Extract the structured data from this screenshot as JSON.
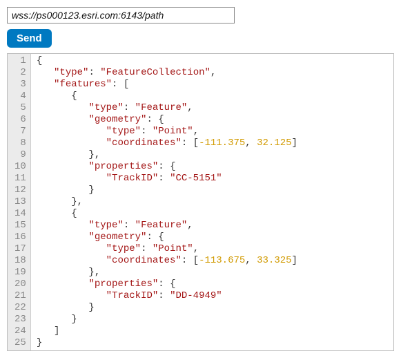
{
  "url_input": {
    "value": "wss://ps000123.esri.com:6143/path"
  },
  "send_button": {
    "label": "Send"
  },
  "code": {
    "line_count": 25,
    "lines": {
      "l1": [
        {
          "t": "{",
          "c": "brace"
        }
      ],
      "l2": [
        {
          "t": "   ",
          "c": "punc"
        },
        {
          "t": "\"type\"",
          "c": "key"
        },
        {
          "t": ": ",
          "c": "punc"
        },
        {
          "t": "\"FeatureCollection\"",
          "c": "str"
        },
        {
          "t": ",",
          "c": "punc"
        }
      ],
      "l3": [
        {
          "t": "   ",
          "c": "punc"
        },
        {
          "t": "\"features\"",
          "c": "key"
        },
        {
          "t": ": [",
          "c": "punc"
        }
      ],
      "l4": [
        {
          "t": "      {",
          "c": "brace"
        }
      ],
      "l5": [
        {
          "t": "         ",
          "c": "punc"
        },
        {
          "t": "\"type\"",
          "c": "key"
        },
        {
          "t": ": ",
          "c": "punc"
        },
        {
          "t": "\"Feature\"",
          "c": "str"
        },
        {
          "t": ",",
          "c": "punc"
        }
      ],
      "l6": [
        {
          "t": "         ",
          "c": "punc"
        },
        {
          "t": "\"geometry\"",
          "c": "key"
        },
        {
          "t": ": {",
          "c": "punc"
        }
      ],
      "l7": [
        {
          "t": "            ",
          "c": "punc"
        },
        {
          "t": "\"type\"",
          "c": "key"
        },
        {
          "t": ": ",
          "c": "punc"
        },
        {
          "t": "\"Point\"",
          "c": "str"
        },
        {
          "t": ",",
          "c": "punc"
        }
      ],
      "l8": [
        {
          "t": "            ",
          "c": "punc"
        },
        {
          "t": "\"coordinates\"",
          "c": "key"
        },
        {
          "t": ": [",
          "c": "punc"
        },
        {
          "t": "-111.375",
          "c": "num"
        },
        {
          "t": ", ",
          "c": "punc"
        },
        {
          "t": "32.125",
          "c": "num"
        },
        {
          "t": "]",
          "c": "punc"
        }
      ],
      "l9": [
        {
          "t": "         },",
          "c": "brace"
        }
      ],
      "l10": [
        {
          "t": "         ",
          "c": "punc"
        },
        {
          "t": "\"properties\"",
          "c": "key"
        },
        {
          "t": ": {",
          "c": "punc"
        }
      ],
      "l11": [
        {
          "t": "            ",
          "c": "punc"
        },
        {
          "t": "\"TrackID\"",
          "c": "key"
        },
        {
          "t": ": ",
          "c": "punc"
        },
        {
          "t": "\"CC-5151\"",
          "c": "str"
        }
      ],
      "l12": [
        {
          "t": "         }",
          "c": "brace"
        }
      ],
      "l13": [
        {
          "t": "      },",
          "c": "brace"
        }
      ],
      "l14": [
        {
          "t": "      {",
          "c": "brace"
        }
      ],
      "l15": [
        {
          "t": "         ",
          "c": "punc"
        },
        {
          "t": "\"type\"",
          "c": "key"
        },
        {
          "t": ": ",
          "c": "punc"
        },
        {
          "t": "\"Feature\"",
          "c": "str"
        },
        {
          "t": ",",
          "c": "punc"
        }
      ],
      "l16": [
        {
          "t": "         ",
          "c": "punc"
        },
        {
          "t": "\"geometry\"",
          "c": "key"
        },
        {
          "t": ": {",
          "c": "punc"
        }
      ],
      "l17": [
        {
          "t": "            ",
          "c": "punc"
        },
        {
          "t": "\"type\"",
          "c": "key"
        },
        {
          "t": ": ",
          "c": "punc"
        },
        {
          "t": "\"Point\"",
          "c": "str"
        },
        {
          "t": ",",
          "c": "punc"
        }
      ],
      "l18": [
        {
          "t": "            ",
          "c": "punc"
        },
        {
          "t": "\"coordinates\"",
          "c": "key"
        },
        {
          "t": ": [",
          "c": "punc"
        },
        {
          "t": "-113.675",
          "c": "num"
        },
        {
          "t": ", ",
          "c": "punc"
        },
        {
          "t": "33.325",
          "c": "num"
        },
        {
          "t": "]",
          "c": "punc"
        }
      ],
      "l19": [
        {
          "t": "         },",
          "c": "brace"
        }
      ],
      "l20": [
        {
          "t": "         ",
          "c": "punc"
        },
        {
          "t": "\"properties\"",
          "c": "key"
        },
        {
          "t": ": {",
          "c": "punc"
        }
      ],
      "l21": [
        {
          "t": "            ",
          "c": "punc"
        },
        {
          "t": "\"TrackID\"",
          "c": "key"
        },
        {
          "t": ": ",
          "c": "punc"
        },
        {
          "t": "\"DD-4949\"",
          "c": "str"
        }
      ],
      "l22": [
        {
          "t": "         }",
          "c": "brace"
        }
      ],
      "l23": [
        {
          "t": "      }",
          "c": "brace"
        }
      ],
      "l24": [
        {
          "t": "   ]",
          "c": "punc"
        }
      ],
      "l25": [
        {
          "t": "}",
          "c": "brace"
        }
      ]
    }
  }
}
